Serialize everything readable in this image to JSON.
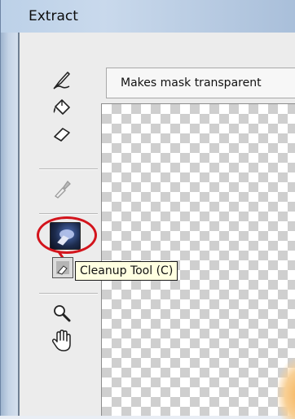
{
  "window": {
    "title": "Extract"
  },
  "description_bar": {
    "text": "Makes mask transparent"
  },
  "tooltip": {
    "text": "Cleanup Tool (C)"
  },
  "toolbox": {
    "tools": [
      {
        "name": "edge-highlighter-tool",
        "icon": "marker-pen-icon"
      },
      {
        "name": "fill-tool",
        "icon": "paint-bucket-icon"
      },
      {
        "name": "eraser-tool",
        "icon": "eraser-icon"
      },
      {
        "name": "eyedropper-tool",
        "icon": "eyedropper-icon"
      },
      {
        "name": "cleanup-tool",
        "icon": "cleanup-icon",
        "selected": true
      },
      {
        "name": "edge-touchup-tool",
        "icon": "edge-touchup-icon"
      },
      {
        "name": "zoom-tool",
        "icon": "magnifier-icon"
      },
      {
        "name": "hand-tool",
        "icon": "hand-icon"
      }
    ]
  },
  "colors": {
    "highlight_ring": "#d3141c",
    "tooltip_bg": "#ffffe1"
  }
}
